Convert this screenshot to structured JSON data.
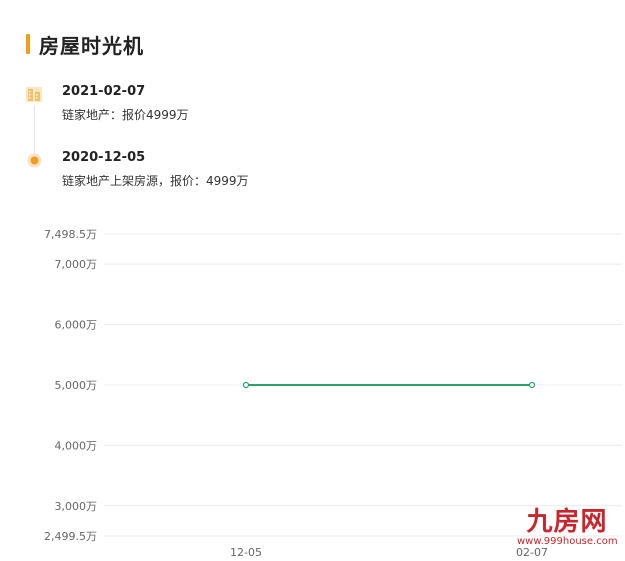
{
  "section": {
    "title": "房屋时光机"
  },
  "timeline": {
    "items": [
      {
        "date": "2021-02-07",
        "desc": "链家地产：报价4999万",
        "icon": "building-icon"
      },
      {
        "date": "2020-12-05",
        "desc": "链家地产上架房源，报价：4999万",
        "icon": "dot-icon"
      }
    ]
  },
  "colors": {
    "accent": "#f0a01e",
    "line": "#2aa36b",
    "grid": "#ececec",
    "watermark": "#c9252c"
  },
  "chart_data": {
    "type": "line",
    "categories": [
      "12-05",
      "02-07"
    ],
    "series": [
      {
        "values": [
          4999,
          4999
        ]
      }
    ],
    "yticks": [
      2499.5,
      3000,
      4000,
      5000,
      6000,
      7000,
      7498.5
    ],
    "ytick_labels": [
      "2,499.5万",
      "3,000万",
      "4,000万",
      "5,000万",
      "6,000万",
      "7,000万",
      "7,498.5万"
    ],
    "ylim": [
      2499.5,
      7498.5
    ],
    "grid": true
  },
  "watermark": {
    "main": "九房网",
    "sub": "www.999house.com"
  }
}
